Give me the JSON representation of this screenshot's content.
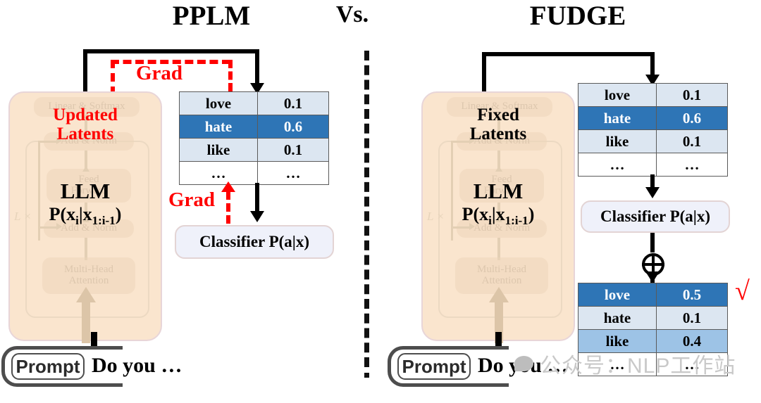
{
  "titles": {
    "left": "PPLM",
    "middle": "Vs.",
    "right": "FUDGE"
  },
  "colors": {
    "panel_fill": "#fae5ce",
    "panel_border": "#e8d5d8",
    "table_pale": "#dce6f1",
    "table_mid": "#9dc3e6",
    "table_dark": "#2e75b6",
    "classifier_fill": "#eff1fa",
    "classifier_border": "#e3d4d4",
    "accent_red": "#ff0000",
    "arrow_black": "#000000",
    "prompt_border": "#4d4d4d",
    "watermark": "#c9c9c9"
  },
  "left_panel": {
    "latents_label_line1": "Updated",
    "latents_label_line2": "Latents",
    "llm_name": "LLM",
    "llm_prob": "P(x",
    "llm_prob_sub1": "i",
    "llm_prob_mid": "|x",
    "llm_prob_sub2": "1:i-1",
    "llm_prob_end": ")",
    "transformer": {
      "linear_softmax": "Linear & Softmax",
      "add_norm_top": "Add & Norm",
      "feed_forward_l1": "Feed",
      "feed_forward_l2": "Forward",
      "add_norm_bottom": "Add & Norm",
      "attention_l1": "Multi-Head",
      "attention_l2": "Attention",
      "repeat": "L ×"
    },
    "classifier": "Classifier P(a|x)",
    "grad_top": "Grad",
    "grad_bottom": "Grad",
    "prompt_chip": "Prompt",
    "prompt_text": "Do you …"
  },
  "right_panel": {
    "latents_label_line1": "Fixed",
    "latents_label_line2": "Latents",
    "llm_name": "LLM",
    "transformer": {
      "linear_softmax": "Linear & Softmax",
      "add_norm_top": "Add & Norm",
      "feed_forward_l1": "Feed",
      "feed_forward_l2": "Forward",
      "add_norm_bottom": "Add & Norm",
      "attention_l1": "Multi-Head",
      "attention_l2": "Attention",
      "repeat": "L ×"
    },
    "classifier": "Classifier P(a|x)",
    "combine_symbol": "⊕",
    "checkmark": "√",
    "prompt_chip": "Prompt",
    "prompt_text": "Do you …"
  },
  "tables": {
    "pplm": {
      "rows": [
        {
          "token": "love",
          "prob": "0.1",
          "style": "pale"
        },
        {
          "token": "hate",
          "prob": "0.6",
          "style": "dark"
        },
        {
          "token": "like",
          "prob": "0.1",
          "style": "pale"
        },
        {
          "token": "…",
          "prob": "…",
          "style": "white"
        }
      ]
    },
    "fudge_lm": {
      "rows": [
        {
          "token": "love",
          "prob": "0.1",
          "style": "pale"
        },
        {
          "token": "hate",
          "prob": "0.6",
          "style": "dark"
        },
        {
          "token": "like",
          "prob": "0.1",
          "style": "pale"
        },
        {
          "token": "…",
          "prob": "…",
          "style": "white"
        }
      ]
    },
    "fudge_combined": {
      "rows": [
        {
          "token": "love",
          "prob": "0.5",
          "style": "dark"
        },
        {
          "token": "hate",
          "prob": "0.1",
          "style": "pale"
        },
        {
          "token": "like",
          "prob": "0.4",
          "style": "mid"
        },
        {
          "token": "…",
          "prob": "…",
          "style": "white"
        }
      ]
    }
  },
  "watermark": {
    "text": "公众号：NLP工作站"
  }
}
